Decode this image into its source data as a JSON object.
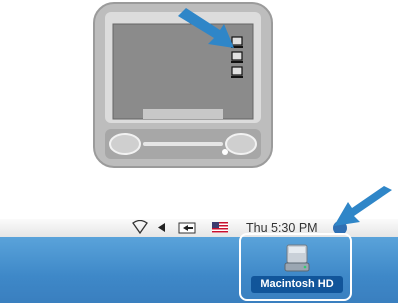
{
  "colors": {
    "arrow": "#2f86c8",
    "desktop": "#4a92d0",
    "label_bg": "#11559a",
    "monitor_body": "#bdbdbd",
    "monitor_screen": "#8c8c8c"
  },
  "monitor_illustration": {
    "drive_icons": [
      "drive-icon",
      "drive-icon",
      "drive-icon"
    ]
  },
  "menubar": {
    "icons": [
      "wifi-icon",
      "volume-icon",
      "display-icon",
      "flag-icon",
      "spotlight-icon"
    ],
    "clock": "Thu 5:30 PM"
  },
  "desktop": {
    "hd_label": "Macintosh HD",
    "hd_icon": "hard-drive-icon"
  }
}
